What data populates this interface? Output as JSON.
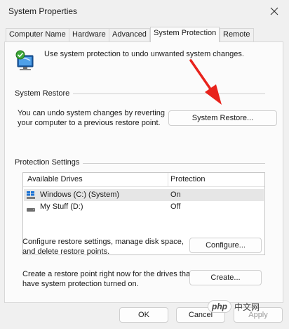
{
  "window": {
    "title": "System Properties"
  },
  "tabs": [
    {
      "label": "Computer Name",
      "active": false
    },
    {
      "label": "Hardware",
      "active": false
    },
    {
      "label": "Advanced",
      "active": false
    },
    {
      "label": "System Protection",
      "active": true
    },
    {
      "label": "Remote",
      "active": false
    }
  ],
  "intro": {
    "text": "Use system protection to undo unwanted system changes."
  },
  "system_restore": {
    "title": "System Restore",
    "description_line1": "You can undo system changes by reverting",
    "description_line2": "your computer to a previous restore point.",
    "button_label": "System Restore..."
  },
  "protection": {
    "title": "Protection Settings",
    "columns": [
      "Available Drives",
      "Protection"
    ],
    "drives": [
      {
        "name": "Windows (C:) (System)",
        "protection": "On",
        "icon": "windows-drive-icon",
        "selected": true
      },
      {
        "name": "My Stuff (D:)",
        "protection": "Off",
        "icon": "drive-icon",
        "selected": false
      }
    ],
    "configure_text_line1": "Configure restore settings, manage disk space,",
    "configure_text_line2": "and delete restore points.",
    "configure_button": "Configure...",
    "create_text_line1": "Create a restore point right now for the drives that",
    "create_text_line2": "have system protection turned on.",
    "create_button": "Create..."
  },
  "footer": {
    "ok": "OK",
    "cancel": "Cancel",
    "apply": "Apply"
  },
  "watermark": {
    "logo_text": "php",
    "text": "中文网"
  },
  "colors": {
    "arrow": "#e8231c",
    "accent": "#0067c0"
  }
}
